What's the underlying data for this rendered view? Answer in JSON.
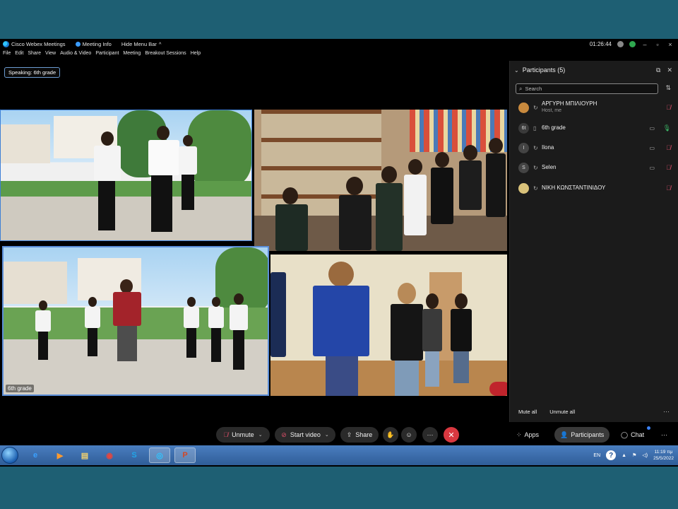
{
  "titlebar": {
    "app_name": "Cisco Webex Meetings",
    "meeting_info": "Meeting Info",
    "hide_menu": "Hide Menu Bar",
    "timer": "01:26:44"
  },
  "menu": [
    "File",
    "Edit",
    "Share",
    "View",
    "Audio & Video",
    "Participant",
    "Meeting",
    "Breakout Sessions",
    "Help"
  ],
  "speaking": "Speaking: 6th grade",
  "tiles": {
    "active_label": "6th grade"
  },
  "participants": {
    "title": "Participants (5)",
    "search_placeholder": "Search",
    "list": [
      {
        "name": "ΑΡΓΥΡΗ ΜΠΙΛΙΟΥΡΗ",
        "sub": "Host, me",
        "initial": "",
        "mic": "off",
        "video": false,
        "avatar_color": "#c98a3e"
      },
      {
        "name": "6th grade",
        "sub": "",
        "initial": "6t",
        "mic": "on",
        "video": true,
        "avatar_color": "#3a3a3a"
      },
      {
        "name": "Ilona",
        "sub": "",
        "initial": "I",
        "mic": "off",
        "video": true,
        "avatar_color": "#444"
      },
      {
        "name": "Selen",
        "sub": "",
        "initial": "S",
        "mic": "off",
        "video": true,
        "avatar_color": "#444"
      },
      {
        "name": "ΝΙΚΗ ΚΩΝΣΤΑΝΤΙΝΙΔΟΥ",
        "sub": "",
        "initial": "",
        "mic": "off",
        "video": false,
        "avatar_color": "#d9c27a"
      }
    ],
    "mute_all": "Mute all",
    "unmute_all": "Unmute all"
  },
  "controls": {
    "unmute": "Unmute",
    "start_video": "Start video",
    "share": "Share",
    "apps": "Apps",
    "participants": "Participants",
    "chat": "Chat"
  },
  "taskbar": {
    "lang": "EN",
    "time": "11:19 πμ",
    "date": "25/5/2022"
  },
  "colors": {
    "accent_blue": "#3d7fd6",
    "end_call": "#d93840",
    "mic_off": "#e0506b",
    "mic_on": "#3dbd6a"
  }
}
